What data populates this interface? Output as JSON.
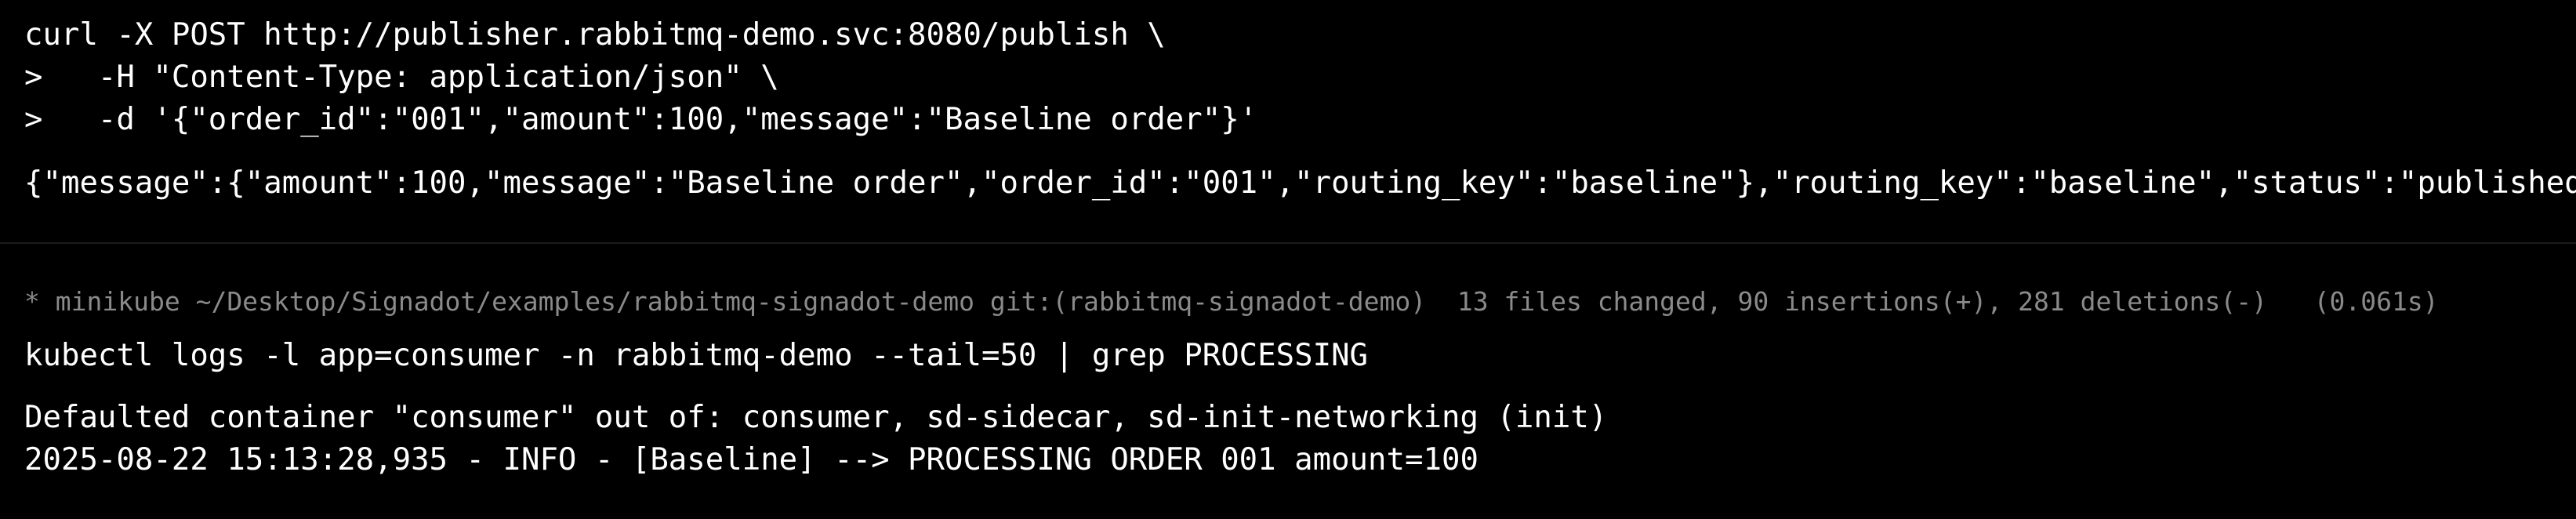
{
  "block1": {
    "command_lines": [
      "curl -X POST http://publisher.rabbitmq-demo.svc:8080/publish \\",
      ">   -H \"Content-Type: application/json\" \\",
      ">   -d '{\"order_id\":\"001\",\"amount\":100,\"message\":\"Baseline order\"}'"
    ],
    "output": "{\"message\":{\"amount\":100,\"message\":\"Baseline order\",\"order_id\":\"001\",\"routing_key\":\"baseline\"},\"routing_key\":\"baseline\",\"status\":\"published\"}"
  },
  "prompt": {
    "marker": "*",
    "context": "minikube",
    "path": "~/Desktop/Signadot/examples/rabbitmq-signadot-demo",
    "git": "git:(rabbitmq-signadot-demo)",
    "stats": "13 files changed, 90 insertions(+), 281 deletions(-)",
    "duration": "(0.061s)"
  },
  "block2": {
    "command": "kubectl logs -l app=consumer -n rabbitmq-demo --tail=50 | grep PROCESSING",
    "output_lines": [
      "Defaulted container \"consumer\" out of: consumer, sd-sidecar, sd-init-networking (init)",
      "2025-08-22 15:13:28,935 - INFO - [Baseline] --> PROCESSING ORDER 001 amount=100"
    ]
  },
  "colors": {
    "background": "#000000",
    "text": "#ffffff",
    "prompt_text": "#8a8a8a",
    "separator": "#1a1a1a"
  }
}
